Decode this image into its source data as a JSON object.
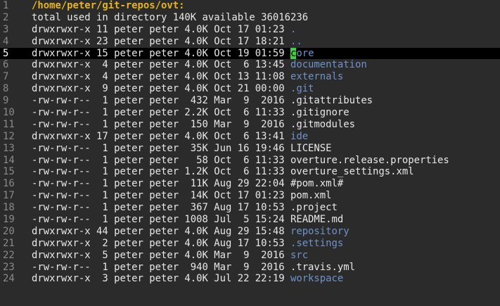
{
  "lines": [
    {
      "num": "1",
      "meta": "",
      "name": "/home/peter/git-repos/ovt:",
      "kind": "header"
    },
    {
      "num": "2",
      "meta": "total used in directory 140K available 36016236",
      "name": "",
      "kind": "file"
    },
    {
      "num": "3",
      "meta": "drwxrwxr-x 11 peter peter 4.0K Oct 17 01:23 ",
      "name": ".",
      "kind": "dir"
    },
    {
      "num": "4",
      "meta": "drwxrwxr-x 23 peter peter 4.0K Oct 17 18:21 ",
      "name": "..",
      "kind": "dir"
    },
    {
      "num": "5",
      "meta": "drwxrwxr-x 15 peter peter 4.0K Oct 19 01:59 ",
      "name": "core",
      "kind": "dir",
      "current": true,
      "cursor_char": "c",
      "rest": "ore"
    },
    {
      "num": "6",
      "meta": "drwxrwxr-x  4 peter peter 4.0K Oct  6 13:45 ",
      "name": "documentation",
      "kind": "dir"
    },
    {
      "num": "7",
      "meta": "drwxrwxr-x  4 peter peter 4.0K Oct 13 11:08 ",
      "name": "externals",
      "kind": "dir"
    },
    {
      "num": "8",
      "meta": "drwxrwxr-x  9 peter peter 4.0K Oct 21 00:00 ",
      "name": ".git",
      "kind": "dir"
    },
    {
      "num": "9",
      "meta": "-rw-rw-r--  1 peter peter  432 Mar  9  2016 ",
      "name": ".gitattributes",
      "kind": "file"
    },
    {
      "num": "10",
      "meta": "-rw-rw-r--  1 peter peter 2.2K Oct  6 11:33 ",
      "name": ".gitignore",
      "kind": "file"
    },
    {
      "num": "11",
      "meta": "-rw-rw-r--  1 peter peter  150 Mar  9  2016 ",
      "name": ".gitmodules",
      "kind": "file"
    },
    {
      "num": "12",
      "meta": "drwxrwxr-x 17 peter peter 4.0K Oct  6 13:41 ",
      "name": "ide",
      "kind": "dir"
    },
    {
      "num": "13",
      "meta": "-rw-rw-r--  1 peter peter  35K Jun 16 19:46 ",
      "name": "LICENSE",
      "kind": "file"
    },
    {
      "num": "14",
      "meta": "-rw-rw-r--  1 peter peter   58 Oct  6 11:33 ",
      "name": "overture.release.properties",
      "kind": "file"
    },
    {
      "num": "15",
      "meta": "-rw-rw-r--  1 peter peter 1.2K Oct  6 11:33 ",
      "name": "overture_settings.xml",
      "kind": "file"
    },
    {
      "num": "16",
      "meta": "-rw-rw-r--  1 peter peter  11K Aug 29 22:04 ",
      "name": "#pom.xml#",
      "kind": "file"
    },
    {
      "num": "17",
      "meta": "-rw-rw-r--  1 peter peter  14K Oct 17 01:23 ",
      "name": "pom.xml",
      "kind": "file"
    },
    {
      "num": "18",
      "meta": "-rw-rw-r--  1 peter peter  367 Aug 17 10:53 ",
      "name": ".project",
      "kind": "file"
    },
    {
      "num": "19",
      "meta": "-rw-rw-r--  1 peter peter 1008 Jul  5 15:24 ",
      "name": "README.md",
      "kind": "file"
    },
    {
      "num": "20",
      "meta": "drwxrwxr-x 44 peter peter 4.0K Aug 29 15:48 ",
      "name": "repository",
      "kind": "dir"
    },
    {
      "num": "21",
      "meta": "drwxrwxr-x  2 peter peter 4.0K Aug 17 10:53 ",
      "name": ".settings",
      "kind": "dir"
    },
    {
      "num": "22",
      "meta": "drwxrwxr-x  5 peter peter 4.0K Mar  9  2016 ",
      "name": "src",
      "kind": "dir"
    },
    {
      "num": "23",
      "meta": "-rw-rw-r--  1 peter peter  940 Mar  9  2016 ",
      "name": ".travis.yml",
      "kind": "file"
    },
    {
      "num": "24",
      "meta": "drwxrwxr-x  3 peter peter 4.0K Jul 22 22:19 ",
      "name": "workspace",
      "kind": "dir"
    }
  ],
  "colors": {
    "background": "#2b2b2b",
    "header": "#e6b422",
    "directory": "#6f93c8",
    "file": "#e8e8e8",
    "line_number": "#8a8a8a",
    "cursor": "#3ed13e",
    "current_line": "#000000"
  }
}
